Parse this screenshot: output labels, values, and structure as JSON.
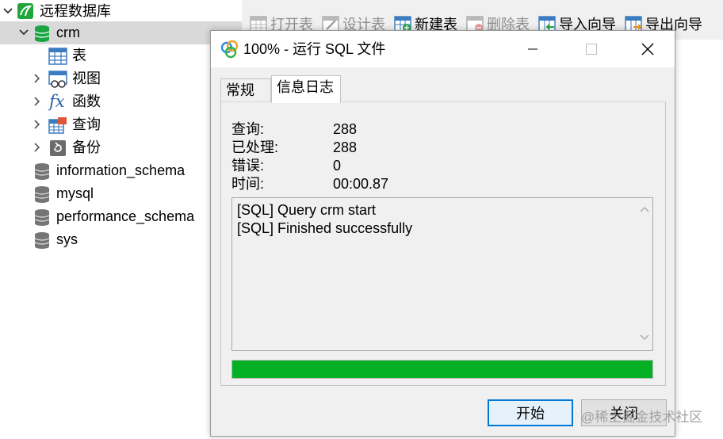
{
  "tree": {
    "connection": "远程数据库",
    "databases": [
      {
        "name": "crm",
        "expanded": true,
        "selected": true,
        "children": [
          {
            "label": "表",
            "icon": "table-icon"
          },
          {
            "label": "视图",
            "icon": "view-icon"
          },
          {
            "label": "函数",
            "icon": "function-icon"
          },
          {
            "label": "查询",
            "icon": "query-icon"
          },
          {
            "label": "备份",
            "icon": "backup-icon"
          }
        ]
      },
      {
        "name": "information_schema"
      },
      {
        "name": "mysql"
      },
      {
        "name": "performance_schema"
      },
      {
        "name": "sys"
      }
    ]
  },
  "toolbar": {
    "buttons": [
      {
        "label": "打开表",
        "enabled": false,
        "icon": "open-table-icon"
      },
      {
        "label": "设计表",
        "enabled": false,
        "icon": "design-table-icon"
      },
      {
        "label": "新建表",
        "enabled": true,
        "icon": "new-table-icon"
      },
      {
        "label": "删除表",
        "enabled": false,
        "icon": "delete-table-icon"
      },
      {
        "label": "导入向导",
        "enabled": true,
        "icon": "import-wizard-icon"
      },
      {
        "label": "导出向导",
        "enabled": true,
        "icon": "export-wizard-icon"
      }
    ]
  },
  "dialog": {
    "title": "100% - 运行 SQL 文件",
    "tabs": [
      {
        "label": "常规"
      },
      {
        "label": "信息日志",
        "active": true
      }
    ],
    "stats": [
      {
        "label": "查询:",
        "value": "288"
      },
      {
        "label": "已处理:",
        "value": "288"
      },
      {
        "label": "错误:",
        "value": "0"
      },
      {
        "label": "时间:",
        "value": "00:00.87"
      }
    ],
    "log_lines": [
      "[SQL] Query crm start",
      "[SQL] Finished successfully"
    ],
    "progress_percent": 100,
    "buttons": {
      "start": "开始",
      "close": "关闭"
    }
  },
  "watermark": "@稀土掘金技术社区",
  "colors": {
    "progress": "#06b025",
    "accent": "#0078d7",
    "db_active": "#1aa442",
    "db_inactive": "#757575"
  }
}
